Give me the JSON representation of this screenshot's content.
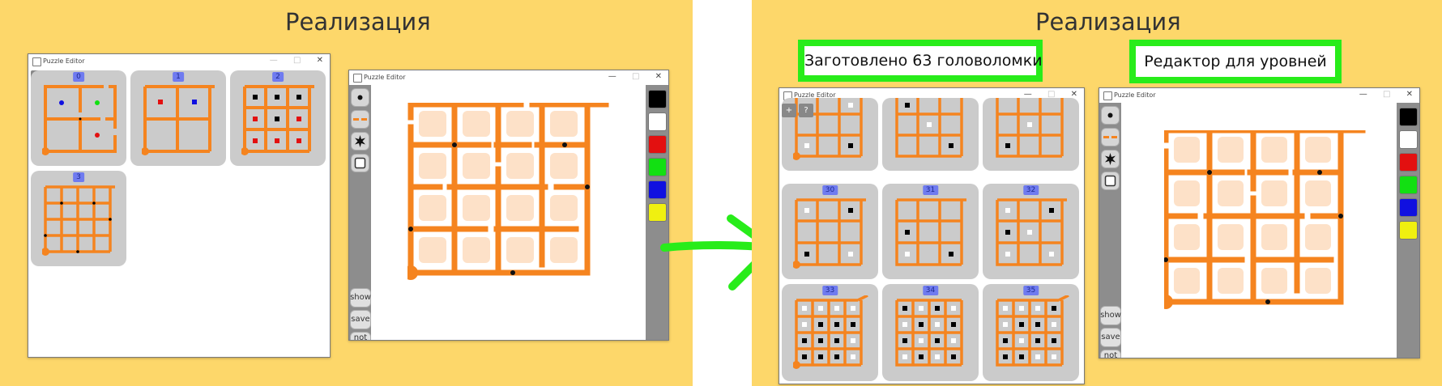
{
  "slides": {
    "left_title": "Реализация",
    "right_title": "Реализация"
  },
  "window_title": "Puzzle Editor",
  "window_controls": {
    "minimize": "—",
    "maximize": "□",
    "close": "✕"
  },
  "gallery_toolbar": {
    "add": "+",
    "help": "?"
  },
  "left_gallery_cards": [
    "0",
    "1",
    "2",
    "3"
  ],
  "right_gallery_cards": [
    "30",
    "31",
    "32",
    "33",
    "34",
    "35"
  ],
  "editor_buttons": {
    "show": "show",
    "save": "save",
    "not_save": "not save"
  },
  "palette_colors": [
    "#000000",
    "#ffffff",
    "#e31010",
    "#12e012",
    "#1010e0",
    "#f0f010"
  ],
  "callouts": {
    "prepared": "Заготовлено 63 головоломки",
    "editor": "Редактор для уровней"
  },
  "colors": {
    "path": "#f5841f",
    "background": "#fdd76a",
    "arrow": "#28ec1a",
    "cell": "#fde1c8"
  }
}
